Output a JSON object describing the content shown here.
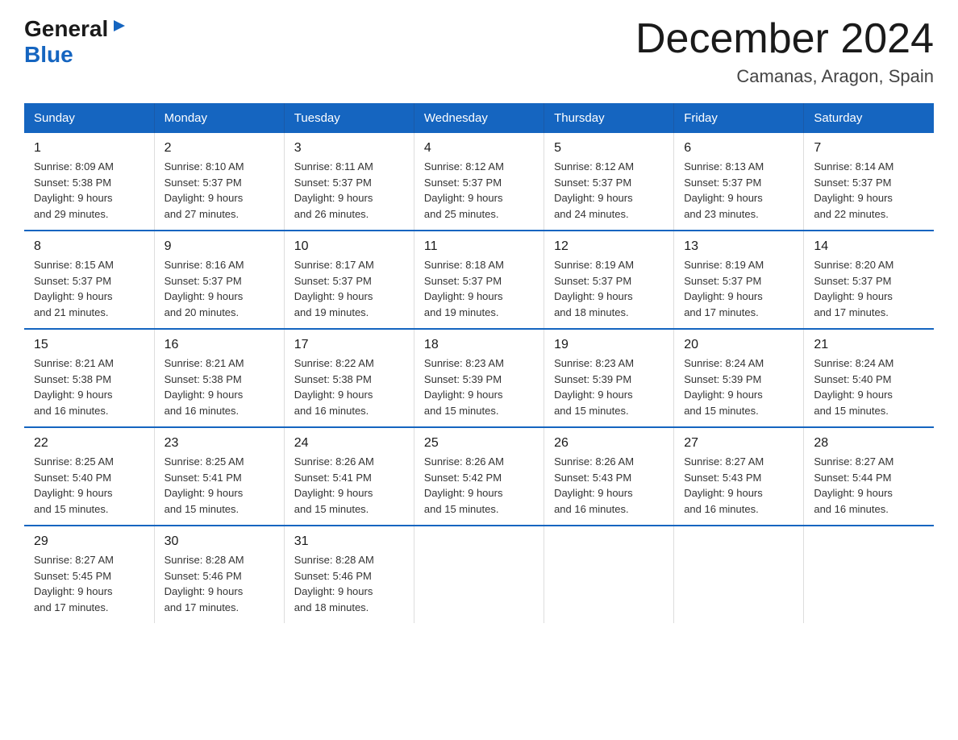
{
  "logo": {
    "general": "General",
    "triangle": "▶",
    "blue": "Blue"
  },
  "title": "December 2024",
  "subtitle": "Camanas, Aragon, Spain",
  "columns": [
    "Sunday",
    "Monday",
    "Tuesday",
    "Wednesday",
    "Thursday",
    "Friday",
    "Saturday"
  ],
  "weeks": [
    [
      {
        "day": "1",
        "sunrise": "8:09 AM",
        "sunset": "5:38 PM",
        "daylight": "9 hours and 29 minutes."
      },
      {
        "day": "2",
        "sunrise": "8:10 AM",
        "sunset": "5:37 PM",
        "daylight": "9 hours and 27 minutes."
      },
      {
        "day": "3",
        "sunrise": "8:11 AM",
        "sunset": "5:37 PM",
        "daylight": "9 hours and 26 minutes."
      },
      {
        "day": "4",
        "sunrise": "8:12 AM",
        "sunset": "5:37 PM",
        "daylight": "9 hours and 25 minutes."
      },
      {
        "day": "5",
        "sunrise": "8:12 AM",
        "sunset": "5:37 PM",
        "daylight": "9 hours and 24 minutes."
      },
      {
        "day": "6",
        "sunrise": "8:13 AM",
        "sunset": "5:37 PM",
        "daylight": "9 hours and 23 minutes."
      },
      {
        "day": "7",
        "sunrise": "8:14 AM",
        "sunset": "5:37 PM",
        "daylight": "9 hours and 22 minutes."
      }
    ],
    [
      {
        "day": "8",
        "sunrise": "8:15 AM",
        "sunset": "5:37 PM",
        "daylight": "9 hours and 21 minutes."
      },
      {
        "day": "9",
        "sunrise": "8:16 AM",
        "sunset": "5:37 PM",
        "daylight": "9 hours and 20 minutes."
      },
      {
        "day": "10",
        "sunrise": "8:17 AM",
        "sunset": "5:37 PM",
        "daylight": "9 hours and 19 minutes."
      },
      {
        "day": "11",
        "sunrise": "8:18 AM",
        "sunset": "5:37 PM",
        "daylight": "9 hours and 19 minutes."
      },
      {
        "day": "12",
        "sunrise": "8:19 AM",
        "sunset": "5:37 PM",
        "daylight": "9 hours and 18 minutes."
      },
      {
        "day": "13",
        "sunrise": "8:19 AM",
        "sunset": "5:37 PM",
        "daylight": "9 hours and 17 minutes."
      },
      {
        "day": "14",
        "sunrise": "8:20 AM",
        "sunset": "5:37 PM",
        "daylight": "9 hours and 17 minutes."
      }
    ],
    [
      {
        "day": "15",
        "sunrise": "8:21 AM",
        "sunset": "5:38 PM",
        "daylight": "9 hours and 16 minutes."
      },
      {
        "day": "16",
        "sunrise": "8:21 AM",
        "sunset": "5:38 PM",
        "daylight": "9 hours and 16 minutes."
      },
      {
        "day": "17",
        "sunrise": "8:22 AM",
        "sunset": "5:38 PM",
        "daylight": "9 hours and 16 minutes."
      },
      {
        "day": "18",
        "sunrise": "8:23 AM",
        "sunset": "5:39 PM",
        "daylight": "9 hours and 15 minutes."
      },
      {
        "day": "19",
        "sunrise": "8:23 AM",
        "sunset": "5:39 PM",
        "daylight": "9 hours and 15 minutes."
      },
      {
        "day": "20",
        "sunrise": "8:24 AM",
        "sunset": "5:39 PM",
        "daylight": "9 hours and 15 minutes."
      },
      {
        "day": "21",
        "sunrise": "8:24 AM",
        "sunset": "5:40 PM",
        "daylight": "9 hours and 15 minutes."
      }
    ],
    [
      {
        "day": "22",
        "sunrise": "8:25 AM",
        "sunset": "5:40 PM",
        "daylight": "9 hours and 15 minutes."
      },
      {
        "day": "23",
        "sunrise": "8:25 AM",
        "sunset": "5:41 PM",
        "daylight": "9 hours and 15 minutes."
      },
      {
        "day": "24",
        "sunrise": "8:26 AM",
        "sunset": "5:41 PM",
        "daylight": "9 hours and 15 minutes."
      },
      {
        "day": "25",
        "sunrise": "8:26 AM",
        "sunset": "5:42 PM",
        "daylight": "9 hours and 15 minutes."
      },
      {
        "day": "26",
        "sunrise": "8:26 AM",
        "sunset": "5:43 PM",
        "daylight": "9 hours and 16 minutes."
      },
      {
        "day": "27",
        "sunrise": "8:27 AM",
        "sunset": "5:43 PM",
        "daylight": "9 hours and 16 minutes."
      },
      {
        "day": "28",
        "sunrise": "8:27 AM",
        "sunset": "5:44 PM",
        "daylight": "9 hours and 16 minutes."
      }
    ],
    [
      {
        "day": "29",
        "sunrise": "8:27 AM",
        "sunset": "5:45 PM",
        "daylight": "9 hours and 17 minutes."
      },
      {
        "day": "30",
        "sunrise": "8:28 AM",
        "sunset": "5:46 PM",
        "daylight": "9 hours and 17 minutes."
      },
      {
        "day": "31",
        "sunrise": "8:28 AM",
        "sunset": "5:46 PM",
        "daylight": "9 hours and 18 minutes."
      },
      {
        "day": "",
        "sunrise": "",
        "sunset": "",
        "daylight": ""
      },
      {
        "day": "",
        "sunrise": "",
        "sunset": "",
        "daylight": ""
      },
      {
        "day": "",
        "sunrise": "",
        "sunset": "",
        "daylight": ""
      },
      {
        "day": "",
        "sunrise": "",
        "sunset": "",
        "daylight": ""
      }
    ]
  ],
  "labels": {
    "sunrise": "Sunrise:",
    "sunset": "Sunset:",
    "daylight": "Daylight:"
  }
}
